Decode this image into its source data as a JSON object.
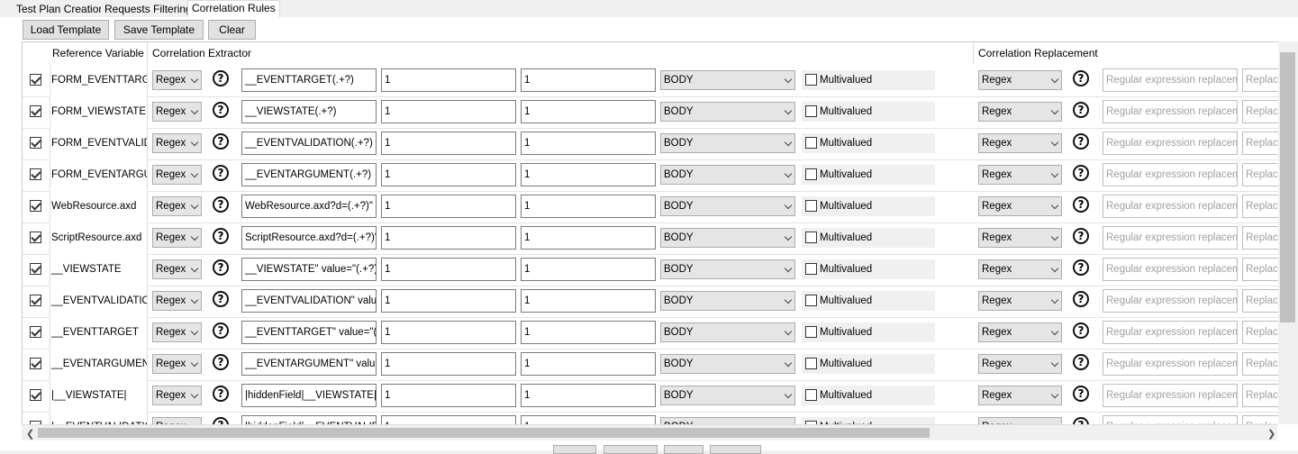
{
  "tabs": [
    "Test Plan Creation",
    "Requests Filtering",
    "Correlation Rules"
  ],
  "toolbar": {
    "load_label": "Load Template",
    "save_label": "Save Template",
    "clear_label": "Clear"
  },
  "headers": {
    "reference_variable": "Reference Variable",
    "correlation_extractor": "Correlation Extractor",
    "correlation_replacement": "Correlation Replacement"
  },
  "common": {
    "extractor_type": "Regex",
    "match_number": "1",
    "group_number": "1",
    "target": "BODY",
    "multivalued_label": "Multivalued",
    "replacement_type": "Regex",
    "replacement_placeholder": "Regular expression replacement",
    "replace_placeholder2": "Replace",
    "help_glyph": "?"
  },
  "rows": [
    {
      "enabled": true,
      "reference": "FORM_EVENTTARGET",
      "regex": "__EVENTTARGET(.+?)"
    },
    {
      "enabled": true,
      "reference": "FORM_VIEWSTATE",
      "regex": "__VIEWSTATE(.+?)"
    },
    {
      "enabled": true,
      "reference": "FORM_EVENTVALIDATION",
      "regex": "__EVENTVALIDATION(.+?)"
    },
    {
      "enabled": true,
      "reference": "FORM_EVENTARGUMENT",
      "regex": "__EVENTARGUMENT(.+?)"
    },
    {
      "enabled": true,
      "reference": "WebResource.axd",
      "regex": "WebResource.axd?d=(.+?)\""
    },
    {
      "enabled": true,
      "reference": "ScriptResource.axd",
      "regex": "ScriptResource.axd?d=(.+?)\""
    },
    {
      "enabled": true,
      "reference": "__VIEWSTATE",
      "regex": "__VIEWSTATE\" value=\"(.+?)\""
    },
    {
      "enabled": true,
      "reference": "__EVENTVALIDATION",
      "regex": "__EVENTVALIDATION\" value=\"(.+?)\""
    },
    {
      "enabled": true,
      "reference": "__EVENTTARGET",
      "regex": "__EVENTTARGET\" value=\"(.+?)\""
    },
    {
      "enabled": true,
      "reference": "__EVENTARGUMENT",
      "regex": "__EVENTARGUMENT\" value=\"(.+?)\""
    },
    {
      "enabled": true,
      "reference": "|__VIEWSTATE|",
      "regex": "|hiddenField|__VIEWSTATE|(.+?)|"
    },
    {
      "enabled": true,
      "reference": "|__EVENTVALIDATION|",
      "regex": "|hiddenField|__EVENTVALIDATION|(.+?)|"
    }
  ]
}
